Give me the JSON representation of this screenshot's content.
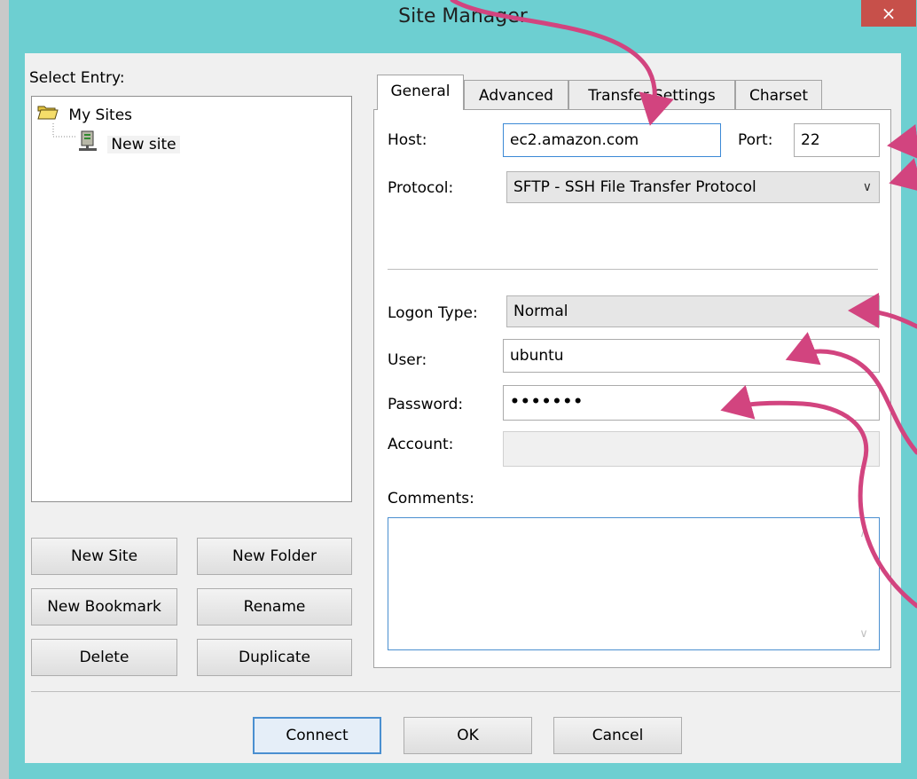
{
  "window": {
    "title": "Site Manager",
    "close_icon": "×"
  },
  "left": {
    "select_entry_label": "Select Entry:",
    "tree": {
      "root_label": "My Sites",
      "child_label": "New site"
    },
    "buttons": {
      "new_site": "New Site",
      "new_folder": "New Folder",
      "new_bookmark": "New Bookmark",
      "rename": "Rename",
      "delete": "Delete",
      "duplicate": "Duplicate"
    }
  },
  "tabs": {
    "general": "General",
    "advanced": "Advanced",
    "transfer_settings": "Transfer Settings",
    "charset": "Charset"
  },
  "general": {
    "host_label": "Host:",
    "host_value": "ec2.amazon.com",
    "port_label": "Port:",
    "port_value": "22",
    "protocol_label": "Protocol:",
    "protocol_value": "SFTP - SSH File Transfer Protocol",
    "logon_type_label": "Logon Type:",
    "logon_type_value": "Normal",
    "user_label": "User:",
    "user_value": "ubuntu",
    "password_label": "Password:",
    "password_value": "•••••••",
    "account_label": "Account:",
    "account_value": "",
    "comments_label": "Comments:"
  },
  "footer": {
    "connect": "Connect",
    "ok": "OK",
    "cancel": "Cancel"
  },
  "colors": {
    "title_bar": "#6dcfd1",
    "close_button": "#c7504a",
    "annotation_arrow": "#d2447f",
    "focus_border": "#3c89d6"
  }
}
